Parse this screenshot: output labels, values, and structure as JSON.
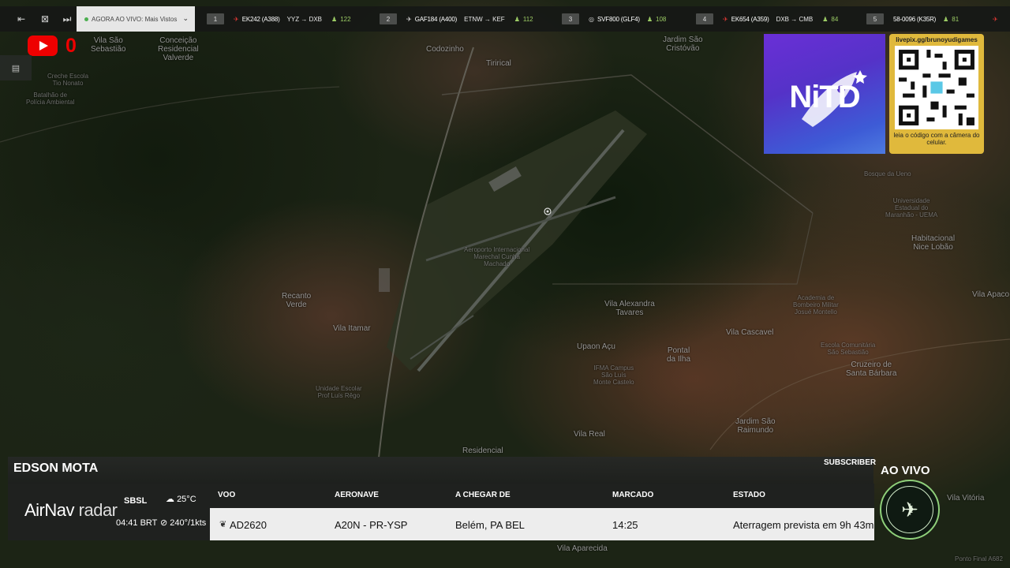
{
  "topbar": {
    "live_label": "AGORA AO VIVO: Mais Vistos",
    "flights": [
      {
        "num": "1",
        "code": "EK242 (A388)",
        "route": "YYZ → DXB",
        "count": "122"
      },
      {
        "num": "2",
        "code": "GAF184 (A400)",
        "route": "ETNW → KEF",
        "count": "112"
      },
      {
        "num": "3",
        "code": "SVF800 (GLF4)",
        "route": "",
        "count": "108"
      },
      {
        "num": "4",
        "code": "EK654 (A359)",
        "route": "DXB → CMB",
        "count": "84"
      },
      {
        "num": "5",
        "code": "58-0096 (K35R)",
        "route": "",
        "count": "81"
      }
    ]
  },
  "youtube": {
    "viewer_count": "0"
  },
  "map": {
    "labels": [
      "Vila São\nSebastião",
      "Conceição\nResidencial\nValverde",
      "Codozinho",
      "Tirirical",
      "Jardim São\nCristóvão",
      "Habitacional\nNice Lobão",
      "Recanto\nVerde",
      "Vila Itamar",
      "Aeroporto Internacional\nMarechal Cunha\nMachado",
      "Vila Alexandra\nTavares",
      "Vila Cascavel",
      "Upaon Açu",
      "Pontal\nda Ilha",
      "Cruzeiro de\nSanta Bárbara",
      "Jardim São\nRaimundo",
      "Vila Real",
      "Residencial",
      "Vila Aparecida",
      "Vila Apaco",
      "Vila Vitória",
      "Ponto Final A682",
      "Bosque da Ueno",
      "Universidade\nEstadual do\nMaranhão - UEMA",
      "Academia de\nBombeiro Militar\nJosué Montello",
      "Batalhão de\nPolícia Ambiental",
      "Creche Escola\nTio Nonato",
      "Unidade Escolar\nProf Luís Rêgo",
      "IFMA Campus\nSão Luís\nMonte Castelo",
      "Escola Comunitária\nSão Sebastião"
    ]
  },
  "promo": {
    "logo_text": "NiTD",
    "qr_url": "livepix.gg/brunoyudigames",
    "qr_caption": "leia o código com a câmera do celular."
  },
  "panel": {
    "channel_name": "EDSON MOTA",
    "subscribe": "SUBSCRIBER",
    "brand_air": "AirNav",
    "brand_radar": "radar",
    "airport": "SBSL",
    "local_time": "04:41 BRT",
    "temperature": "25°C",
    "wind": "240°/1kts",
    "headers": {
      "flight": "VOO",
      "aircraft": "AERONAVE",
      "origin": "A CHEGAR DE",
      "scheduled": "MARCADO",
      "status": "ESTADO"
    },
    "row": {
      "flight": "AD2620",
      "aircraft": "A20N - PR-YSP",
      "origin": "Belém, PA BEL",
      "scheduled": "14:25",
      "status": "Aterragem prevista em 9h 43m"
    }
  },
  "live_badge": {
    "label": "AO VIVO"
  },
  "colors": {
    "accent_green": "#9ccc65",
    "youtube_red": "#ee0000",
    "qr_gold": "#e0b93c"
  }
}
